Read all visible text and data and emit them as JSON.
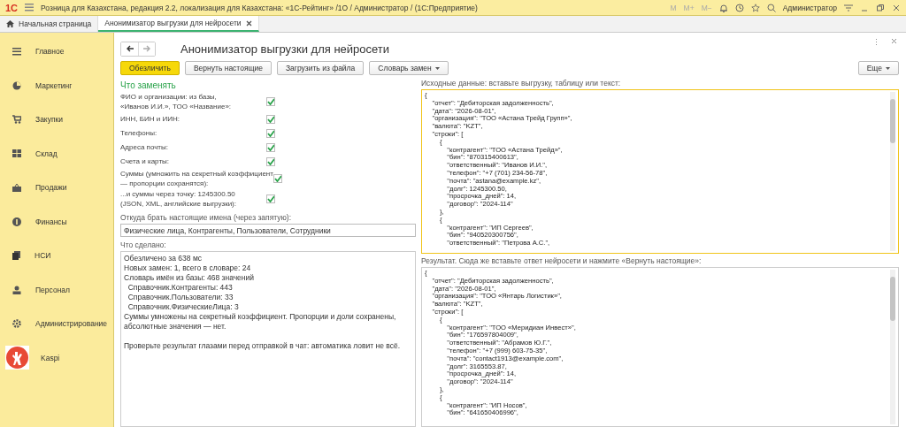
{
  "window": {
    "title": "Розница для Казахстана, редакция 2.2, локализация для Казахстана: «1С-Рейтинг» /1О / Администратор /  (1С:Предприятие)",
    "logo": "1С",
    "memory_buttons": [
      "M",
      "M+",
      "M−"
    ],
    "user": "Администратор"
  },
  "tabs": [
    {
      "label": "Начальная страница",
      "selected": false
    },
    {
      "label": "Анонимизатор выгрузки для нейросети",
      "selected": true
    }
  ],
  "sidebar": {
    "items": [
      {
        "label": "Главное"
      },
      {
        "label": "Маркетинг"
      },
      {
        "label": "Закупки"
      },
      {
        "label": "Склад"
      },
      {
        "label": "Продажи"
      },
      {
        "label": "Финансы"
      },
      {
        "label": "НСИ"
      },
      {
        "label": "Персонал"
      },
      {
        "label": "Администрирование"
      },
      {
        "label": "Kaspi"
      }
    ]
  },
  "form": {
    "title": "Анонимизатор выгрузки для нейросети",
    "more_actions": "⋮",
    "buttons": [
      {
        "label": "Обезличить",
        "kind": "primary"
      },
      {
        "label": "Вернуть настоящие",
        "kind": "plain"
      },
      {
        "label": "Загрузить из файла",
        "kind": "plain"
      },
      {
        "label": "Словарь замен",
        "kind": "dropdown"
      }
    ],
    "more_button": "Еще",
    "options_title": "Что заменять",
    "options": [
      {
        "label": "ФИО и организации: из базы,\n«Иванов И.И.», ТОО «Название»:",
        "checked": true
      },
      {
        "label": "ИНН, БИН и ИИН:",
        "checked": true
      },
      {
        "label": "Телефоны:",
        "checked": true
      },
      {
        "label": "Адреса почты:",
        "checked": true
      },
      {
        "label": "Счета и карты:",
        "checked": true
      },
      {
        "label": "Суммы (умножить на секретный коэффициент\n— пропорции сохранятся):",
        "checked": true
      },
      {
        "label": "...и суммы через точку: 1245300.50\n(JSON, XML, английские выгрузки):",
        "checked": true
      }
    ],
    "names_label": "Откуда брать настоящие имена (через запятую):",
    "names_value": "Физические лица, Контрагенты, Пользователи, Сотрудники",
    "log_label": "Что сделано:",
    "log_paragraphs": [
      [
        "Обезличено за 638 мс",
        "Новых замен: 1, всего в словаре: 24",
        "Словарь имён из базы: 468 значений",
        "  Справочник.Контрагенты: 443",
        "  Справочник.Пользователи: 33",
        "  Справочник.ФизическиеЛица: 3",
        "Суммы умножены на секретный коэффициент. Пропорции и доли сохранены, абсолютные значения — нет."
      ],
      [
        "Проверьте результат глазами перед отправкой в чат: автоматика ловит не всё."
      ]
    ],
    "source_label": "Исходные данные: вставьте выгрузку, таблицу или текст:",
    "source_focused": true,
    "source_lines": [
      "{",
      "    \"отчет\": \"Дебиторская задолженность\",",
      "    \"дата\": \"2026-08-01\",",
      "    \"организация\": \"ТОО «Астана Трейд Групп»\",",
      "    \"валюта\": \"KZT\",",
      "    \"строки\": [",
      "        {",
      "            \"контрагент\": \"ТОО «Астана Трейд»\",",
      "            \"бин\": \"870315400613\",",
      "            \"ответственный\": \"Иванов И.И.\",",
      "            \"телефон\": \"+7 (701) 234-56-78\",",
      "            \"почта\": \"astana@example.kz\",",
      "            \"долг\": 1245300.50,",
      "            \"просрочка_дней\": 14,",
      "            \"договор\": \"2024-114\"",
      "        },",
      "        {",
      "            \"контрагент\": \"ИП Сергеев\",",
      "            \"бин\": \"940520300756\",",
      "            \"ответственный\": \"Петрова А.С.\","
    ],
    "result_label": "Результат. Сюда же вставьте ответ нейросети и нажмите «Вернуть настоящие»:",
    "result_lines": [
      "{",
      "    \"отчет\": \"Дебиторская задолженность\",",
      "    \"дата\": \"2026-08-01\",",
      "    \"организация\": \"ТОО «Янтарь Логистик»\",",
      "    \"валюта\": \"KZT\",",
      "    \"строки\": [",
      "        {",
      "            \"контрагент\": \"ТОО «Меридиан Инвест»\",",
      "            \"бин\": \"176597804009\",",
      "            \"ответственный\": \"Абрамов Ю.Г.\",",
      "            \"телефон\": \"+7 (999) 603-75-35\",",
      "            \"почта\": \"contact1913@example.com\",",
      "            \"долг\": 3165553.87,",
      "            \"просрочка_дней\": 14,",
      "            \"договор\": \"2024-114\"",
      "        },",
      "        {",
      "            \"контрагент\": \"ИП Носов\",",
      "            \"бин\": \"641650406996\","
    ]
  }
}
